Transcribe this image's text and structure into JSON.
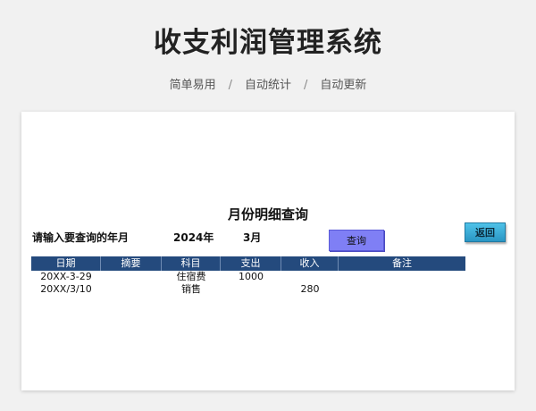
{
  "hero": {
    "title": "收支利润管理系统",
    "features": [
      "简单易用",
      "自动统计",
      "自动更新"
    ],
    "separator": "/"
  },
  "panel": {
    "title": "月份明细查询",
    "query_label": "请输入要查询的年月",
    "year": "2024年",
    "month": "3月",
    "query_button": "查询",
    "back_button": "返回"
  },
  "table": {
    "columns": [
      "日期",
      "摘要",
      "科目",
      "支出",
      "收入",
      "备注"
    ],
    "rows": [
      [
        "20XX-3-29",
        "",
        "住宿费",
        "1000",
        "",
        ""
      ],
      [
        "20XX/3/10",
        "",
        "销售",
        "",
        "280",
        ""
      ]
    ]
  },
  "colors": {
    "header_bg": "#244a7d",
    "query_button": "#7f7ff5",
    "back_button": "#35a8d6"
  }
}
